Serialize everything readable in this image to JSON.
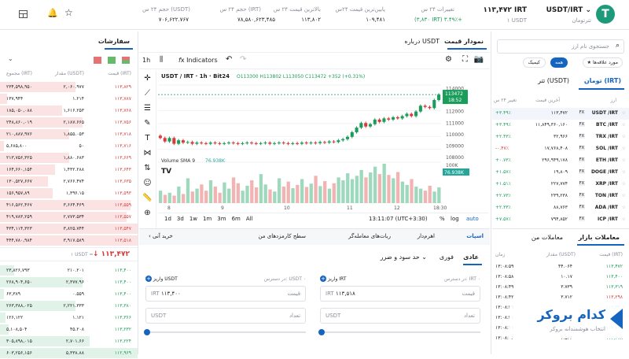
{
  "header": {
    "pair": "USDT/IRT",
    "brand": "تترتومان",
    "price": "۱۱۳,۴۷۲ IRT",
    "price_sub": "۱ USDT",
    "change_label": "تغییرات ۲۴ س",
    "change_val": "(۳,۸۳۰ IRT) ۳.۴۹٪+",
    "low_label": "پایین‌ترین قیمت ۲۴س",
    "low_val": "۱۰۹,۴۸۱",
    "high_label": "بالاترین قیمت ۲۴ س",
    "high_val": "۱۱۳,۸۰۲",
    "vol_irt_label": "حجم ۲۴ س (IRT)",
    "vol_irt_val": "۷۸,۵۸۰,۶۲۳,۴۸۵",
    "vol_usdt_label": "حجم ۲۴ س (USDT)",
    "vol_usdt_val": "۷۰۶,۶۲۲.۷۶۷"
  },
  "market": {
    "search_placeholder": "جستجوی نام ارز",
    "filter_fav": "مورد علاقه‌ها",
    "filter_all": "همه",
    "filter_cashback": "کیمیک",
    "tab_toman": "تومان (IRT)",
    "tab_tether": "تتر (USDT)",
    "col_name": "ارز",
    "col_price": "آخرین قیمت",
    "col_change": "تغییر ۲۴ س",
    "rows": [
      {
        "fx": "FX",
        "pair": "USDT /IRT",
        "price": "۱۱۳,۴۷۲",
        "change": "+۳.۴۹٪",
        "up": true
      },
      {
        "fx": "FX",
        "pair": "BTC /IRT",
        "price": "۱۱,۸۴۹,۳۶۰,۱۶۰",
        "change": "+۳.۴۹٪",
        "up": true
      },
      {
        "fx": "FX",
        "pair": "TRX /IRT",
        "price": "۳۲,۹۶۶",
        "change": "+۲.۴۳٪",
        "up": true
      },
      {
        "fx": "FX",
        "pair": "SOL /IRT",
        "price": "۱۷,۷۶۸,۴۰۸",
        "change": "-۰.۴۷٪",
        "up": false
      },
      {
        "fx": "FX",
        "pair": "ETH /IRT",
        "price": "۲۹۶,۹۴۹,۱۷۸",
        "change": "+۰.۷۳٪",
        "up": true
      },
      {
        "fx": "FX",
        "pair": "DOGE /IRT",
        "price": "۱۹,۸۰۹",
        "change": "+۱.۵۷٪",
        "up": true
      },
      {
        "fx": "FX",
        "pair": "XRP /IRT",
        "price": "۲۲۷,۷۷۴",
        "change": "+۱.۵۱٪",
        "up": true
      },
      {
        "fx": "FX",
        "pair": "TON /IRT",
        "price": "۲۳۹,۲۳۸",
        "change": "+۲.۷۳٪",
        "up": true
      },
      {
        "fx": "FX",
        "pair": "ADA /IRT",
        "price": "۸۸,۷۶۳",
        "change": "+۲.۳۳٪",
        "up": true
      },
      {
        "fx": "FX",
        "pair": "ICP /IRT",
        "price": "۷۹۴,۸۵۲",
        "change": "+۷.۵۷٪",
        "up": true
      }
    ]
  },
  "trades": {
    "tab_market": "معاملات بازار",
    "tab_mine": "معاملات من",
    "col_price": "قیمت (IRT)",
    "col_amount": "مقدار (USDT)",
    "col_time": "زمان",
    "rows": [
      {
        "p": "۱۱۳,۴۷۲",
        "a": "۴۴.۰۶۴",
        "t": "۱۳:۰۸:۵۹",
        "up": true
      },
      {
        "p": "۱۱۳,۴۰۰",
        "a": "۱۰.۱۷",
        "t": "۱۳:۰۸:۵۸",
        "up": true
      },
      {
        "p": "۱۱۳,۳۱۹",
        "a": "۳.۷۳۹",
        "t": "۱۳:۰۸:۴۹",
        "up": true
      },
      {
        "p": "۱۱۳,۲۹۸",
        "a": "۳.۷۱۲",
        "t": "۱۳:۰۸:۴۲",
        "up": false
      },
      {
        "p": "۱۱۳,۳۴۰",
        "a": "",
        "t": "۱۳:۰۸:۳۹",
        "up": true
      },
      {
        "p": "۱۱۳,۳۹۵",
        "a": "",
        "t": "۱۳:۰۸:۲۱",
        "up": true
      },
      {
        "p": "۱۱۳,۲۲۹",
        "a": "",
        "t": "۱۳:۰۸:۱۱",
        "up": true
      },
      {
        "p": "۱۱۳,۳۷۸",
        "a": "۲.۵۳۳",
        "t": "۱۳:۰۸:۰۶",
        "up": true
      }
    ]
  },
  "chart": {
    "tab_chart": "نمودار قیمت",
    "tab_about": "درباره USDT",
    "interval": "1h",
    "indicators": "Indicators",
    "symbol": "USDT / IRT · 1h · Bit24",
    "ohlc": "O113300 H113802 L113050 C113472 +352 (+0.31%)",
    "volume_label": "Volume SMA 9",
    "volume_val": "76.938K",
    "price_tag": "113472",
    "price_tag_time": "18:52",
    "vol_tag": "76.938K",
    "y_ticks": [
      "114000",
      "112000",
      "111000",
      "110000",
      "109000",
      "108000",
      "107000",
      "100K"
    ],
    "x_ticks": [
      "8",
      "9",
      "10",
      "11",
      "12",
      "18:30"
    ],
    "ranges": [
      "1d",
      "3d",
      "1w",
      "1m",
      "3m",
      "6m",
      "All"
    ],
    "clock": "13:11:07 (UTC+3:30)",
    "pct": "%",
    "log": "log",
    "auto": "auto",
    "tv": "TV"
  },
  "chart_data": {
    "type": "candlestick",
    "title": "USDT / IRT · 1h · Bit24",
    "ylim": [
      107600,
      114300
    ],
    "closes": [
      109700,
      109400,
      109700,
      109200,
      109500,
      109300,
      109350,
      109200,
      109300,
      109250,
      109200,
      109300,
      109250,
      109200,
      109250,
      109300,
      109250,
      109200,
      109250,
      109300,
      109250,
      109200,
      109250,
      109300,
      109200,
      109250,
      109300,
      109250,
      109200,
      109250,
      109200,
      109300,
      109250,
      109300,
      109250,
      109350,
      109300,
      109400,
      109350,
      109500,
      109600,
      109800,
      110200,
      110600,
      111000,
      110700,
      110900,
      111300,
      111100,
      111400,
      111300,
      111500,
      111400,
      111600,
      111800,
      111600,
      112000,
      112500,
      112400,
      112300,
      113000,
      113472
    ],
    "volumes": [
      30,
      20,
      25,
      18,
      40,
      22,
      60,
      28,
      35,
      45,
      30,
      55,
      40,
      25,
      50,
      35,
      62,
      48,
      30,
      42,
      55,
      38,
      70,
      45,
      33,
      28,
      60,
      40,
      52,
      36,
      44,
      58,
      39,
      47,
      66,
      41,
      53,
      35,
      48,
      62,
      55,
      72,
      58,
      66,
      80,
      62,
      74,
      88,
      70,
      95,
      68,
      60,
      75,
      52,
      44,
      58,
      40,
      35,
      30,
      42,
      28,
      38
    ]
  },
  "trade_panel": {
    "tabs": [
      "اسپات",
      "اهرم‌دار",
      "ربات‌های معامله‌گر",
      "سطح کارمزدهای من"
    ],
    "buy_label": "خرید آنی",
    "order_types": [
      "عادی",
      "فوری",
      "حد سود و ضرر"
    ],
    "buy_avail": "در دسترس: IRT ۰",
    "buy_deposit": "واریز IRT",
    "buy_price_unit": "IRT",
    "buy_price_label": "قیمت",
    "buy_price_val": "۱۱۳,۵۱۸",
    "buy_amount_unit": "USDT",
    "buy_amount_label": "تعداد",
    "sell_avail": "در دسترس: USDT ۰",
    "sell_deposit": "واریز USDT",
    "sell_price_unit": "IRT",
    "sell_price_label": "قیمت",
    "sell_price_val": "۱۱۳,۴۰۰",
    "sell_amount_unit": "USDT",
    "sell_amount_label": "تعداد"
  },
  "orderbook": {
    "title": "سفارشات",
    "col_price": "قیمت (IRT)",
    "col_amount": "مقدار (USDT)",
    "col_total": "مجموع (IRT)",
    "asks": [
      {
        "p": "۱۱۳,۸۲۹",
        "a": "۲,۰۶۰.۹۷۷",
        "t": "۲۳۴,۵۹۸,۹۵۰",
        "d": 0.55
      },
      {
        "p": "۱۱۳,۷۸۷",
        "a": "۱.۲۱۴",
        "t": "۱۳۷,۹۴۴",
        "d": 0.05
      },
      {
        "p": "۱۱۳,۷۶۸",
        "a": "۱,۶۱۶.۲۵۳",
        "t": "۱۸۵,۰۵۰,۰۸۸",
        "d": 0.45
      },
      {
        "p": "۱۱۳,۷۵۶",
        "a": "۲,۱۸۷.۶۶۵",
        "t": "۲۴۸,۸۶۰,۰۱۹",
        "d": 0.6
      },
      {
        "p": "۱۱۳,۷۱۸",
        "a": "۱,۸۵۵.۰۵۳",
        "t": "۲۱۰,۸۸۷,۹۷۶",
        "d": 0.5
      },
      {
        "p": "۱۱۳,۷۱۶",
        "a": "۵۰",
        "t": "۵,۶۸۵,۸۰۰",
        "d": 0.03
      },
      {
        "p": "۱۱۳,۶۶۹",
        "a": "۱,۸۸۰.۶۸۳",
        "t": "۲۱۳,۷۵۶,۳۲۵",
        "d": 0.5
      },
      {
        "p": "۱۱۳,۶۴۳",
        "a": "۱,۴۳۲.۲۸۸",
        "t": "۱۶۴,۶۶۰,۱۵۴",
        "d": 0.4
      },
      {
        "p": "۱۱۳,۶۳۵",
        "a": "۲,۷۶۶.۴۷۴",
        "t": "۱۳۰,۵۲۷,۶۶۷",
        "d": 0.35
      },
      {
        "p": "۱۱۳,۵۹۳",
        "a": "۱,۳۹۶.۱۵",
        "t": "۱۵۶,۹۵۷,۸۹",
        "d": 0.38
      },
      {
        "p": "۱۱۳,۵۵۹",
        "a": "۳,۶۶۴.۴۶۹",
        "t": "۴۱۶,۵۶۲,۴۶۷",
        "d": 0.95
      },
      {
        "p": "۱۱۳,۵۵۷",
        "a": "۲,۷۷۳.۵۳۴",
        "t": "۴۱۹,۷۸۳,۲۵۹",
        "d": 0.92
      },
      {
        "p": "۱۱۳,۵۴۷",
        "a": "۳,۸۲۵.۷۴۴",
        "t": "۴۳۴,۱۱۴,۳۲۳",
        "d": 1.0
      },
      {
        "p": "۱۱۳,۵۱۸",
        "a": "۳,۹۱۷.۵۸۹",
        "t": "۴۴۴,۷۸۰,۹۸۴",
        "d": 1.0
      }
    ],
    "mid_price": "۱۱۳,۴۷۲",
    "mid_sub": "۱ USDT =",
    "bids": [
      {
        "p": "۱۱۳,۴۰۰",
        "a": "۲۱۰.۲۰۱",
        "t": "۲۳,۸۲۶,۷۹۳",
        "d": 0.1
      },
      {
        "p": "۱۱۳,۴۰۰",
        "a": "۲,۳۷۷.۹۶",
        "t": "۲۶۸,۹۰۴,۶۵۰",
        "d": 0.6
      },
      {
        "p": "۱۱۳,۴۰۰",
        "a": "۰.۵۵۹",
        "t": "۶۳,۳۸۹",
        "d": 0.03
      },
      {
        "p": "۱۱۳,۳۸۰",
        "a": "۲,۲۲۱.۳۳۳",
        "t": "۲۶۳,۳۸۸,۰۲۵",
        "d": 0.55
      },
      {
        "p": "۱۱۳,۳۶۶",
        "a": "۱.۱۲۱",
        "t": "۱۲۶,۱۲۲",
        "d": 0.04
      },
      {
        "p": "۱۱۳,۲۳۲",
        "a": "۴۵.۲۰۸",
        "t": "۵,۱۰۸,۵۰۴",
        "d": 0.06
      },
      {
        "p": "۱۱۳,۲۲۴",
        "a": "۲,۷۰۱.۶۶",
        "t": "۳۰۵,۸۹۸,۰۱۵",
        "d": 0.65
      },
      {
        "p": "۱۱۲,۹۶۹",
        "a": "۵,۳۳۸.۸۸",
        "t": "۶۰۳,۲۵۶,۱۵۶",
        "d": 1.0
      }
    ]
  },
  "brand": {
    "name": "کدام بروکر",
    "tagline": "انتخاب هوشمندانه بروکر"
  },
  "colors": {
    "up": "#1a9c5a",
    "down": "#d83a3a",
    "accent": "#1565c0"
  }
}
